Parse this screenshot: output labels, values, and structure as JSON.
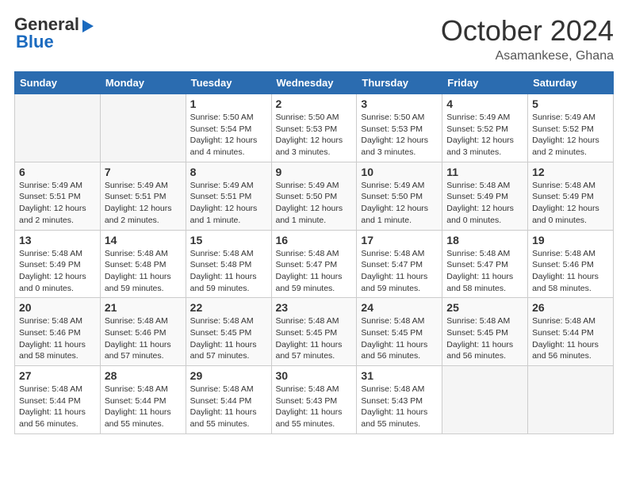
{
  "logo": {
    "general": "General",
    "blue": "Blue"
  },
  "title": {
    "month_year": "October 2024",
    "location": "Asamankese, Ghana"
  },
  "weekdays": [
    "Sunday",
    "Monday",
    "Tuesday",
    "Wednesday",
    "Thursday",
    "Friday",
    "Saturday"
  ],
  "weeks": [
    [
      {
        "day": "",
        "info": ""
      },
      {
        "day": "",
        "info": ""
      },
      {
        "day": "1",
        "info": "Sunrise: 5:50 AM\nSunset: 5:54 PM\nDaylight: 12 hours and 4 minutes."
      },
      {
        "day": "2",
        "info": "Sunrise: 5:50 AM\nSunset: 5:53 PM\nDaylight: 12 hours and 3 minutes."
      },
      {
        "day": "3",
        "info": "Sunrise: 5:50 AM\nSunset: 5:53 PM\nDaylight: 12 hours and 3 minutes."
      },
      {
        "day": "4",
        "info": "Sunrise: 5:49 AM\nSunset: 5:52 PM\nDaylight: 12 hours and 3 minutes."
      },
      {
        "day": "5",
        "info": "Sunrise: 5:49 AM\nSunset: 5:52 PM\nDaylight: 12 hours and 2 minutes."
      }
    ],
    [
      {
        "day": "6",
        "info": "Sunrise: 5:49 AM\nSunset: 5:51 PM\nDaylight: 12 hours and 2 minutes."
      },
      {
        "day": "7",
        "info": "Sunrise: 5:49 AM\nSunset: 5:51 PM\nDaylight: 12 hours and 2 minutes."
      },
      {
        "day": "8",
        "info": "Sunrise: 5:49 AM\nSunset: 5:51 PM\nDaylight: 12 hours and 1 minute."
      },
      {
        "day": "9",
        "info": "Sunrise: 5:49 AM\nSunset: 5:50 PM\nDaylight: 12 hours and 1 minute."
      },
      {
        "day": "10",
        "info": "Sunrise: 5:49 AM\nSunset: 5:50 PM\nDaylight: 12 hours and 1 minute."
      },
      {
        "day": "11",
        "info": "Sunrise: 5:48 AM\nSunset: 5:49 PM\nDaylight: 12 hours and 0 minutes."
      },
      {
        "day": "12",
        "info": "Sunrise: 5:48 AM\nSunset: 5:49 PM\nDaylight: 12 hours and 0 minutes."
      }
    ],
    [
      {
        "day": "13",
        "info": "Sunrise: 5:48 AM\nSunset: 5:49 PM\nDaylight: 12 hours and 0 minutes."
      },
      {
        "day": "14",
        "info": "Sunrise: 5:48 AM\nSunset: 5:48 PM\nDaylight: 11 hours and 59 minutes."
      },
      {
        "day": "15",
        "info": "Sunrise: 5:48 AM\nSunset: 5:48 PM\nDaylight: 11 hours and 59 minutes."
      },
      {
        "day": "16",
        "info": "Sunrise: 5:48 AM\nSunset: 5:47 PM\nDaylight: 11 hours and 59 minutes."
      },
      {
        "day": "17",
        "info": "Sunrise: 5:48 AM\nSunset: 5:47 PM\nDaylight: 11 hours and 59 minutes."
      },
      {
        "day": "18",
        "info": "Sunrise: 5:48 AM\nSunset: 5:47 PM\nDaylight: 11 hours and 58 minutes."
      },
      {
        "day": "19",
        "info": "Sunrise: 5:48 AM\nSunset: 5:46 PM\nDaylight: 11 hours and 58 minutes."
      }
    ],
    [
      {
        "day": "20",
        "info": "Sunrise: 5:48 AM\nSunset: 5:46 PM\nDaylight: 11 hours and 58 minutes."
      },
      {
        "day": "21",
        "info": "Sunrise: 5:48 AM\nSunset: 5:46 PM\nDaylight: 11 hours and 57 minutes."
      },
      {
        "day": "22",
        "info": "Sunrise: 5:48 AM\nSunset: 5:45 PM\nDaylight: 11 hours and 57 minutes."
      },
      {
        "day": "23",
        "info": "Sunrise: 5:48 AM\nSunset: 5:45 PM\nDaylight: 11 hours and 57 minutes."
      },
      {
        "day": "24",
        "info": "Sunrise: 5:48 AM\nSunset: 5:45 PM\nDaylight: 11 hours and 56 minutes."
      },
      {
        "day": "25",
        "info": "Sunrise: 5:48 AM\nSunset: 5:45 PM\nDaylight: 11 hours and 56 minutes."
      },
      {
        "day": "26",
        "info": "Sunrise: 5:48 AM\nSunset: 5:44 PM\nDaylight: 11 hours and 56 minutes."
      }
    ],
    [
      {
        "day": "27",
        "info": "Sunrise: 5:48 AM\nSunset: 5:44 PM\nDaylight: 11 hours and 56 minutes."
      },
      {
        "day": "28",
        "info": "Sunrise: 5:48 AM\nSunset: 5:44 PM\nDaylight: 11 hours and 55 minutes."
      },
      {
        "day": "29",
        "info": "Sunrise: 5:48 AM\nSunset: 5:44 PM\nDaylight: 11 hours and 55 minutes."
      },
      {
        "day": "30",
        "info": "Sunrise: 5:48 AM\nSunset: 5:43 PM\nDaylight: 11 hours and 55 minutes."
      },
      {
        "day": "31",
        "info": "Sunrise: 5:48 AM\nSunset: 5:43 PM\nDaylight: 11 hours and 55 minutes."
      },
      {
        "day": "",
        "info": ""
      },
      {
        "day": "",
        "info": ""
      }
    ]
  ]
}
